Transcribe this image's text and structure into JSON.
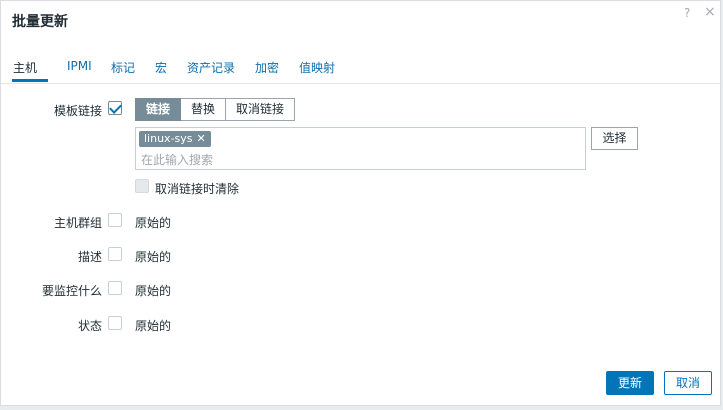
{
  "dialog": {
    "title": "批量更新",
    "help_icon": "?",
    "close_icon": "×"
  },
  "tabs": [
    {
      "label": "主机",
      "active": true
    },
    {
      "label": "IPMI"
    },
    {
      "label": "标记"
    },
    {
      "label": "宏"
    },
    {
      "label": "资产记录"
    },
    {
      "label": "加密"
    },
    {
      "label": "值映射"
    }
  ],
  "form": {
    "template_link": {
      "label": "模板链接",
      "checked": true,
      "segments": [
        "链接",
        "替换",
        "取消链接"
      ],
      "active_segment": "链接",
      "selected_items": [
        "linux-sys"
      ],
      "search_placeholder": "在此输入搜索",
      "select_button": "选择",
      "clear_on_unlink_label": "取消链接时清除"
    },
    "host_groups": {
      "label": "主机群组",
      "value": "原始的"
    },
    "description": {
      "label": "描述",
      "value": "原始的"
    },
    "monitored_by": {
      "label": "要监控什么",
      "value": "原始的"
    },
    "status": {
      "label": "状态",
      "value": "原始的"
    }
  },
  "footer": {
    "update_button": "更新",
    "cancel_button": "取消"
  },
  "colors": {
    "accent": "#0275b8",
    "chip_bg": "#768d99"
  }
}
